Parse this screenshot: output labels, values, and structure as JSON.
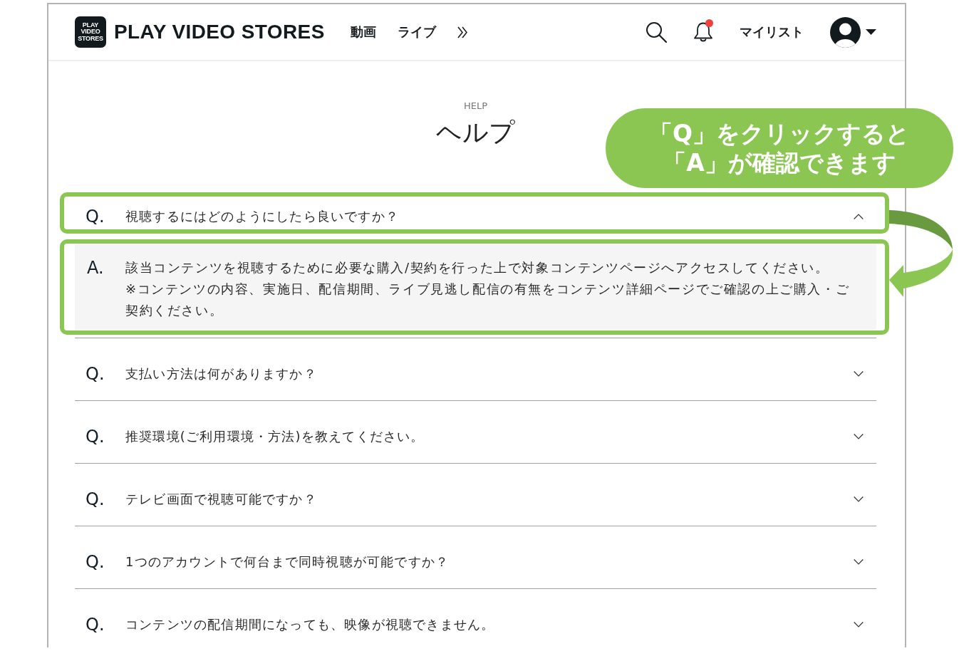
{
  "header": {
    "logo": {
      "tile_lines": [
        "PLAY",
        "VIDEO",
        "STORES"
      ],
      "name": "PLAY VIDEO STORES"
    },
    "nav": [
      {
        "label": "動画"
      },
      {
        "label": "ライブ"
      }
    ],
    "notifications_unread": true,
    "my_list": "マイリスト"
  },
  "page": {
    "eyebrow": "HELP",
    "title": "ヘルプ"
  },
  "callout": {
    "lines": [
      "「Q」をクリックすると",
      "「A」が確認できます"
    ]
  },
  "faq": [
    {
      "q_label": "Q.",
      "question": "視聴するにはどのようにしたら良いですか？",
      "expanded": true,
      "highlighted": true,
      "a_label": "A.",
      "answer": [
        "該当コンテンツを視聴するために必要な購入/契約を行った上で対象コンテンツページへアクセスしてください。",
        "※コンテンツの内容、実施日、配信期間、ライブ見逃し配信の有無をコンテンツ詳細ページでご確認の上ご購入・ご契約ください。"
      ]
    },
    {
      "q_label": "Q.",
      "question": "支払い方法は何がありますか？",
      "expanded": false,
      "highlighted": false
    },
    {
      "q_label": "Q.",
      "question": "推奨環境(ご利用環境・方法)を教えてください。",
      "expanded": false,
      "highlighted": false
    },
    {
      "q_label": "Q.",
      "question": "テレビ画面で視聴可能ですか？",
      "expanded": false,
      "highlighted": false
    },
    {
      "q_label": "Q.",
      "question": "1つのアカウントで何台まで同時視聴が可能ですか？",
      "expanded": false,
      "highlighted": false
    },
    {
      "q_label": "Q.",
      "question": "コンテンツの配信期間になっても、映像が視聴できません。",
      "expanded": false,
      "highlighted": false
    }
  ]
}
